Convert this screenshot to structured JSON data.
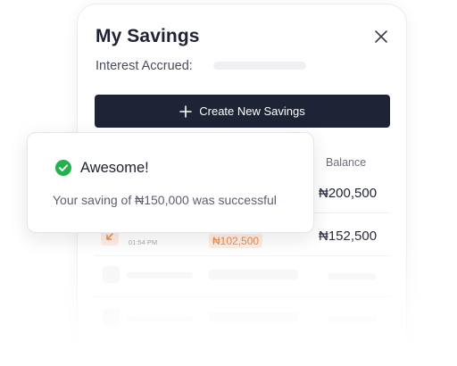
{
  "panel": {
    "title": "My Savings",
    "interest_label": "Interest Accrued:",
    "create_button_label": "Create New Savings"
  },
  "table": {
    "columns": {
      "balance": "Balance"
    },
    "rows": [
      {
        "balance": "₦200,500"
      },
      {
        "time": "01:54 PM",
        "amount": "₦102,500",
        "balance": "₦152,500"
      }
    ]
  },
  "toast": {
    "title": "Awesome!",
    "message": "Your saving of ₦150,000 was successful"
  },
  "colors": {
    "primary": "#1e2336",
    "success": "#22b14c",
    "accent": "#e8823c"
  },
  "icons": {
    "close": "close-icon",
    "plus": "plus-icon",
    "check": "check-circle-icon",
    "arrow": "arrow-down-left-icon"
  }
}
